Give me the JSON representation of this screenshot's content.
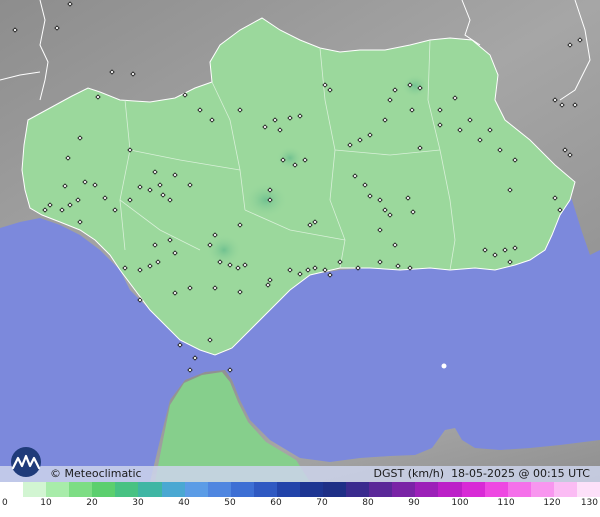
{
  "header": {
    "brand": "© Meteoclimatic",
    "variable": "DGST (km/h)",
    "timestamp": "18-05-2025 @ 00:15 UTC"
  },
  "legend": {
    "ticks": [
      "0",
      "10",
      "20",
      "30",
      "40",
      "50",
      "60",
      "70",
      "80",
      "90",
      "100",
      "110",
      "120",
      "130"
    ],
    "colors": [
      "#ffffff",
      "#d2f5d2",
      "#a8ecaa",
      "#7ddd84",
      "#5ccf6e",
      "#48c283",
      "#3fb6a4",
      "#4aa8d2",
      "#5b9ce6",
      "#4f86e0",
      "#3d6fd4",
      "#2f59c2",
      "#2244aa",
      "#1d3592",
      "#1e2f86",
      "#3a2b8e",
      "#5a2898",
      "#7a24a6",
      "#9c20b8",
      "#bc20c8",
      "#d82ad6",
      "#ee48e2",
      "#f570ea",
      "#f896ef",
      "#fbbcf4",
      "#fde0f9"
    ]
  },
  "colors": {
    "sea": "#7c89dc",
    "land_outside": "#9a9a9a",
    "region": "#9bd89c",
    "border": "#ffffff"
  }
}
